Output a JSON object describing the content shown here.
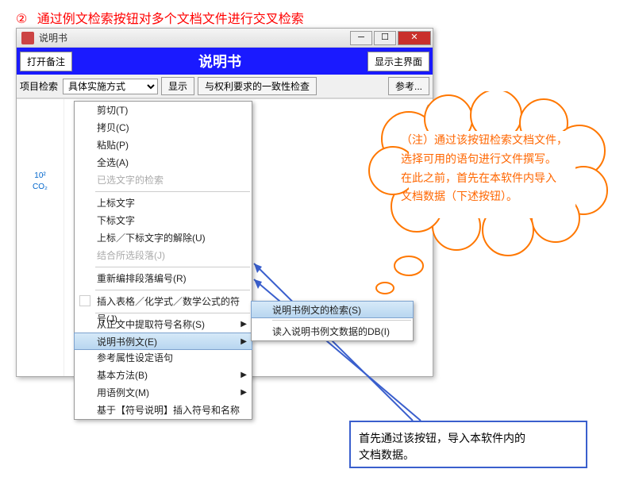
{
  "heading": {
    "num": "②",
    "text": "通过例文检索按钮对多个文档文件进行交叉检索"
  },
  "window": {
    "title": "说明书",
    "bluebar": {
      "open_annot": "打开备注",
      "title": "说明书",
      "show_main": "显示主界面"
    },
    "toolbar": {
      "label": "项目检索",
      "combo_value": "具体实施方式",
      "display_btn": "显示",
      "consistency_btn": "与权利要求的一致性检查",
      "ref_btn": "参考..."
    },
    "superscript_label": "10²",
    "subscript_label": "CO₂",
    "context_menu": {
      "cut": "剪切(T)",
      "copy": "拷贝(C)",
      "paste": "粘贴(P)",
      "select_all": "全选(A)",
      "search_chosen": "已选文字的检索",
      "sup": "上标文字",
      "sub": "下标文字",
      "release": "上标／下标文字的解除(U)",
      "combine_para": "结合所选段落(J)",
      "renum": "重新编排段落编号(R)",
      "insert_symbol": "插入表格／化学式／数学公式的符号(J)",
      "extract_name": "从正文中提取符号名称(S)",
      "example": "说明书例文(E)",
      "attr_sentence": "参考属性设定语句",
      "basic": "基本方法(B)",
      "use_example": "用语例文(M)",
      "insert_by_desc": "基于【符号说明】插入符号和名称"
    },
    "submenu": {
      "search_examples": "说明书例文的检索(S)",
      "read_db": "读入说明书例文数据的DB(I)"
    }
  },
  "cloud": {
    "l1": "（注）通过该按钮检索文档文件，",
    "l2": "选择可用的语句进行文件撰写。",
    "l3": "在此之前，首先在本软件内导入",
    "l4": "文档数据（下述按钮）。"
  },
  "box": {
    "l1": "首先通过该按钮，导入本软件内的",
    "l2": "文档数据。"
  }
}
